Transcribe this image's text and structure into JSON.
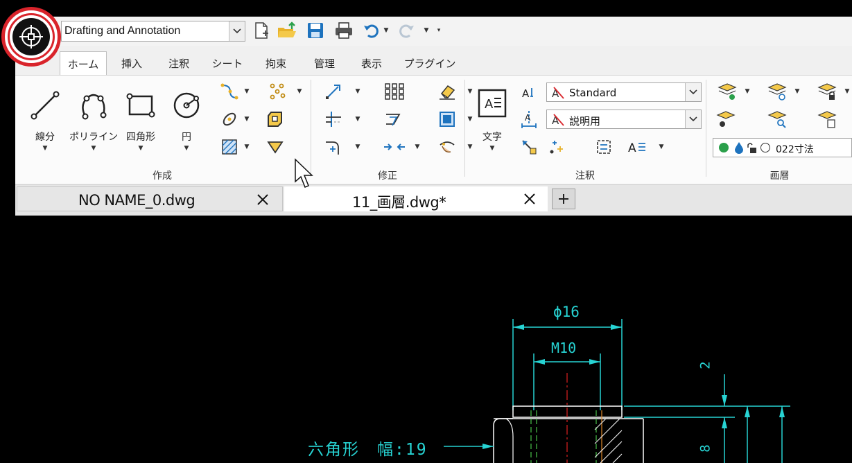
{
  "workspace": {
    "value": "Drafting and Annotation"
  },
  "tabs": [
    {
      "label": "ホーム",
      "active": true
    },
    {
      "label": "挿入"
    },
    {
      "label": "注釈"
    },
    {
      "label": "シート"
    },
    {
      "label": "拘束"
    },
    {
      "label": "管理"
    },
    {
      "label": "表示"
    },
    {
      "label": "プラグイン"
    }
  ],
  "panels": {
    "draw": {
      "title": "作成",
      "line": "線分",
      "polyline": "ポリライン",
      "rectangle": "四角形",
      "circle": "円"
    },
    "modify": {
      "title": "修正"
    },
    "annotation": {
      "title": "注釈",
      "text": "文字",
      "text_style": "Standard",
      "dim_style": "説明用"
    },
    "layers": {
      "title": "画層",
      "current_layer": "022寸法"
    }
  },
  "documents": [
    {
      "name": "NO NAME_0.dwg",
      "active": false
    },
    {
      "name": "11_画層.dwg*",
      "active": true
    }
  ],
  "drawing": {
    "dim_diameter": "ϕ16",
    "dim_thread": "M10",
    "dim_top": "2",
    "dim_side": "8",
    "hex_note": "六角形　幅:19"
  },
  "colors": {
    "accent": "#1e73be",
    "app_ring": "#d9242b",
    "cad_cyan": "#27d3d3",
    "cad_white": "#ffffff",
    "cad_red": "#e02020",
    "cad_green": "#4ac24a",
    "cad_orange": "#e08a2a"
  }
}
